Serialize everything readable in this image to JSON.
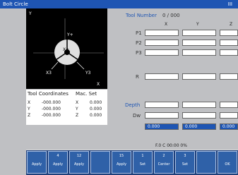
{
  "window": {
    "title": "Bolt Circle",
    "controls": "III"
  },
  "graphic": {
    "labels": [
      "Y",
      "X",
      "X+",
      "Y+",
      "X3",
      "Y3"
    ],
    "colors": {
      "bg": "#000000",
      "fg": "#ffffff",
      "disc": "#e0e0e0"
    }
  },
  "axis_info": {
    "title": "Tool Coordinates",
    "col_head": "Mac.   Set",
    "rows": [
      {
        "axis": "X",
        "a": "-000.000",
        "b": "X",
        "c": "0.000"
      },
      {
        "axis": "Y",
        "a": "-000.000",
        "b": "Y",
        "c": "0.000"
      },
      {
        "axis": "Z",
        "a": "-000.000",
        "b": "Z",
        "c": "0.000"
      }
    ]
  },
  "params": {
    "top_label": "Tool Number",
    "top_value": "0 / 000",
    "col_labels": [
      "X",
      "Y",
      "Z"
    ],
    "rows": [
      {
        "label": "P1"
      },
      {
        "label": "P2"
      },
      {
        "label": "P3"
      },
      {
        "label": "R"
      },
      {
        "label": "Depth"
      },
      {
        "label": "Dw"
      }
    ],
    "highlight_values": [
      "0.000",
      "0.000",
      "0.000"
    ],
    "status": "F.0  C 00:00  0%"
  },
  "softkeys": [
    {
      "top": "",
      "bottom": "Apply"
    },
    {
      "top": "4",
      "bottom": "Apply"
    },
    {
      "top": "12",
      "bottom": "Apply"
    },
    {
      "top": "",
      "bottom": ""
    },
    {
      "top": "15",
      "bottom": "Apply"
    },
    {
      "top": "1",
      "bottom": "Set"
    },
    {
      "top": "2",
      "bottom": "Center"
    },
    {
      "top": "3",
      "bottom": "Set"
    },
    {
      "top": "",
      "bottom": ""
    },
    {
      "top": "",
      "bottom": "OK"
    }
  ]
}
